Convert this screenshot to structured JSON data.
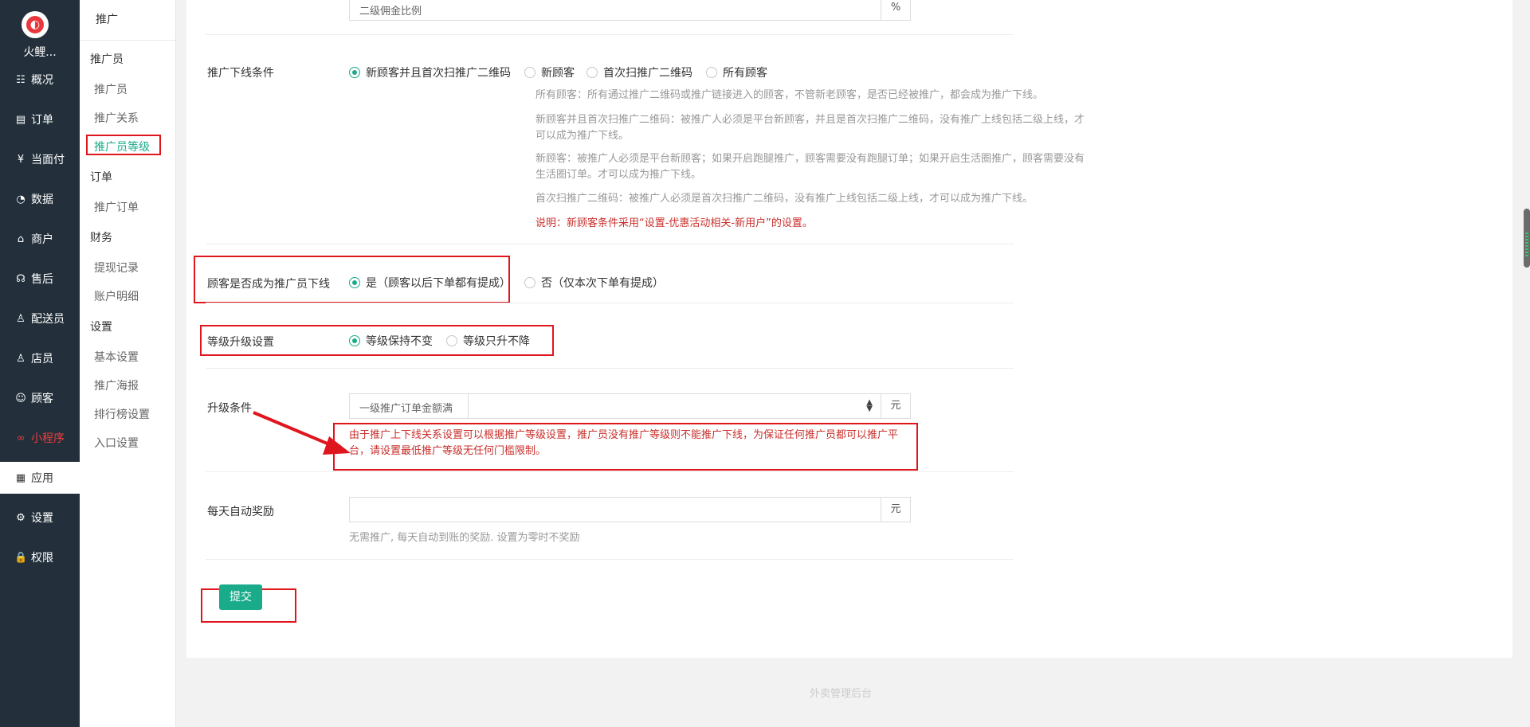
{
  "nav": {
    "brand": "火鲤...",
    "items": [
      {
        "label": "概况",
        "icon": "dashboard-icon",
        "glyph": "☷"
      },
      {
        "label": "订单",
        "icon": "order-icon",
        "glyph": "▤"
      },
      {
        "label": "当面付",
        "icon": "yuan-icon",
        "glyph": "¥"
      },
      {
        "label": "数据",
        "icon": "chart-icon",
        "glyph": "◔"
      },
      {
        "label": "商户",
        "icon": "store-icon",
        "glyph": "⌂"
      },
      {
        "label": "售后",
        "icon": "service-icon",
        "glyph": "☊"
      },
      {
        "label": "配送员",
        "icon": "courier-icon",
        "glyph": "♙"
      },
      {
        "label": "店员",
        "icon": "staff-icon",
        "glyph": "♙"
      },
      {
        "label": "顾客",
        "icon": "customer-icon",
        "glyph": "☺"
      },
      {
        "label": "小程序",
        "icon": "miniapp-icon",
        "glyph": "∞"
      },
      {
        "label": "应用",
        "icon": "apps-icon",
        "glyph": "▦"
      },
      {
        "label": "设置",
        "icon": "gear-icon",
        "glyph": "⚙"
      },
      {
        "label": "权限",
        "icon": "lock-icon",
        "glyph": "🔒"
      }
    ]
  },
  "subnav": {
    "title": "推广",
    "groups": [
      {
        "label": "推广员",
        "links": [
          "推广员",
          "推广关系",
          "推广员等级"
        ]
      },
      {
        "label": "订单",
        "links": [
          "推广订单"
        ]
      },
      {
        "label": "财务",
        "links": [
          "提现记录",
          "账户明细"
        ]
      },
      {
        "label": "设置",
        "links": [
          "基本设置",
          "推广海报",
          "排行榜设置",
          "入口设置"
        ]
      }
    ]
  },
  "form": {
    "level2_placeholder": "二级佣金比例",
    "level2_addon": "%",
    "downline_label": "推广下线条件",
    "downline_options": [
      "新顾客并且首次扫推广二维码",
      "新顾客",
      "首次扫推广二维码",
      "所有顾客"
    ],
    "downline_help": [
      "所有顾客：所有通过推广二维码或推广链接进入的顾客，不管新老顾客，是否已经被推广，都会成为推广下线。",
      "新顾客并且首次扫推广二维码：被推广人必须是平台新顾客，并且是首次扫推广二维码，没有推广上线包括二级上线，才可以成为推广下线。",
      "新顾客：被推广人必须是平台新顾客；如果开启跑腿推广，顾客需要没有跑腿订单；如果开启生活圈推广，顾客需要没有生活圈订单。才可以成为推广下线。",
      "首次扫推广二维码：被推广人必须是首次扫推广二维码，没有推广上线包括二级上线，才可以成为推广下线。"
    ],
    "downline_note": "说明：新顾客条件采用“设置-优惠活动相关-新用户”的设置。",
    "customer_label": "顾客是否成为推广员下线",
    "customer_yes": "是（顾客以后下单都有提成）",
    "customer_no": "否（仅本次下单有提成）",
    "level_label": "等级升级设置",
    "level_keep": "等级保持不变",
    "level_up": "等级只升不降",
    "upgrade_label": "升级条件",
    "upgrade_select": "一级推广订单金额满",
    "upgrade_addon": "元",
    "upgrade_warning": "由于推广上下线关系设置可以根据推广等级设置，推广员没有推广等级则不能推广下线，为保证任何推广员都可以推广平台，请设置最低推广等级无任何门槛限制。",
    "daily_label": "每天自动奖励",
    "daily_value": "",
    "daily_addon": "元",
    "daily_help": "无需推广, 每天自动到账的奖励. 设置为零时不奖励",
    "submit": "提交"
  },
  "footer": "外卖管理后台",
  "colors": {
    "accent": "#1aab8a",
    "highlight": "#e0161e",
    "nav_bg": "#23303b"
  }
}
